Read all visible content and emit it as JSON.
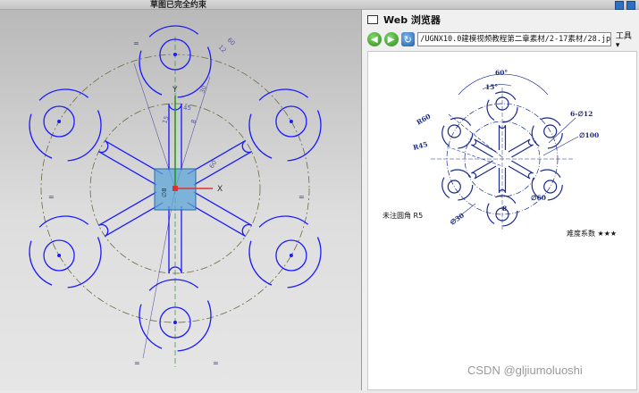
{
  "app": {
    "status_text": "草图已完全约束"
  },
  "browser": {
    "title": "Web 浏览器",
    "url": "/UGNX10.0建模视频教程第二章素材/2-17素材/28.jpg",
    "tools_label": "工具",
    "tools_arrow": "▾"
  },
  "drawing": {
    "dim_angle": "60°",
    "dim_small_angle": "15°",
    "dim_r60": "R60",
    "dim_r45": "R45",
    "dim_holes": "6-∅12",
    "dim_d100": "∅100",
    "dim_d60": "∅60",
    "dim_d30": "∅30",
    "dim_8": "8",
    "note_fillet": "未注圆角 R5",
    "difficulty": "难度系数 ★★★"
  },
  "sketch": {
    "axis_x": "X",
    "axis_y": "Y",
    "dim_labels": [
      "12",
      "60",
      "30",
      "8",
      "60",
      "15",
      "45"
    ],
    "cross_label": "∅8",
    "eq": "="
  },
  "watermark": "CSDN @gljiumoluoshi",
  "colors": {
    "sketch": "#1a1aff",
    "constraint": "#5a5aa8",
    "center_line": "#6b6b40",
    "csys_x": "#e03030",
    "csys_y": "#1a9a1a",
    "csys_box": "#5fa6d8",
    "drawing_line": "#1a2a8a"
  }
}
